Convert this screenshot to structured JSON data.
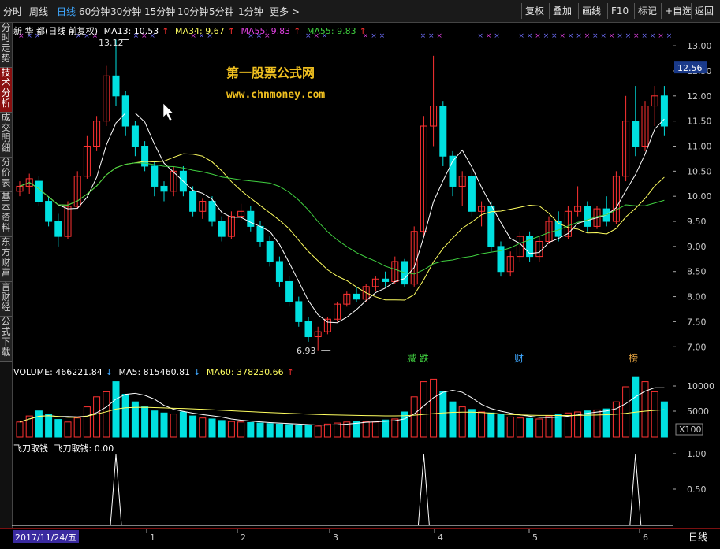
{
  "topbar": {
    "left": [
      "分时",
      "周线",
      "日线",
      "60分钟",
      "30分钟",
      "15分钟",
      "10分钟",
      "5分钟",
      "1分钟",
      "更多 >"
    ],
    "active": "日线",
    "right": [
      "复权",
      "叠加",
      "画线",
      "F10",
      "标记",
      "+自选",
      "返回"
    ]
  },
  "sidebar": [
    "分时走势",
    "技术分析",
    "成交明细",
    "分价表",
    "基本资料",
    "东方财富",
    "言财经",
    "公式下载"
  ],
  "sidebar_active": "技术分析",
  "main_legend": {
    "title": "新 华 都(日线 前复权)",
    "ma13": "MA13: 10.53",
    "ma34": "MA34: 9.67",
    "ma55a": "MA55: 9.83",
    "ma55b": "MA55: 9.83"
  },
  "watermark": {
    "line1": "第一股票公式网",
    "line2": "www.chnmoney.com"
  },
  "annotations": {
    "high": "13.12",
    "low": "6.93",
    "tag1": "减 跌",
    "tag2": "财",
    "tag3": "榜"
  },
  "current_price": "12.56",
  "price_ticks": [
    "13.00",
    "12.50",
    "12.00",
    "11.50",
    "11.00",
    "10.50",
    "10.00",
    "9.50",
    "9.00",
    "8.50",
    "8.00",
    "7.50",
    "7.00"
  ],
  "vol_legend": {
    "vol": "VOLUME: 466221.84",
    "ma5": "MA5: 815460.81",
    "ma60": "MA60: 378230.66"
  },
  "vol_ticks": [
    "10000",
    "5000"
  ],
  "vol_unit": "X100",
  "ind_legend": {
    "name": "飞刀取钱",
    "value": "飞刀取钱: 0.00"
  },
  "ind_ticks": [
    "1.00",
    "0.50"
  ],
  "date_label": "2017/11/24/五",
  "month_ticks": [
    "1",
    "2",
    "3",
    "4",
    "5",
    "6"
  ],
  "period_label": "日线",
  "colors": {
    "up": "#ff3232",
    "down": "#00e0e0",
    "ma13": "#ffffff",
    "ma34": "#ffff60",
    "ma55": "#40d040",
    "accent": "#3fa8ff"
  },
  "chart_data": {
    "type": "candlestick",
    "ylim": [
      6.8,
      13.3
    ],
    "high_marker": 13.12,
    "low_marker": 6.93,
    "candles": [
      [
        10.1,
        10.3,
        10.0,
        10.2
      ],
      [
        10.2,
        10.45,
        10.05,
        10.35
      ],
      [
        10.3,
        10.4,
        9.8,
        9.9
      ],
      [
        9.9,
        10.0,
        9.4,
        9.5
      ],
      [
        9.5,
        9.65,
        9.0,
        9.2
      ],
      [
        9.2,
        9.9,
        9.15,
        9.8
      ],
      [
        9.8,
        10.5,
        9.75,
        10.4
      ],
      [
        10.4,
        11.2,
        10.35,
        11.0
      ],
      [
        11.0,
        11.6,
        10.9,
        11.5
      ],
      [
        11.5,
        12.6,
        11.4,
        12.4
      ],
      [
        12.4,
        13.12,
        11.8,
        12.0
      ],
      [
        12.0,
        12.1,
        11.2,
        11.4
      ],
      [
        11.4,
        11.5,
        10.8,
        11.0
      ],
      [
        11.0,
        11.1,
        10.5,
        10.6
      ],
      [
        10.6,
        10.7,
        10.0,
        10.2
      ],
      [
        10.2,
        10.3,
        9.9,
        10.1
      ],
      [
        10.1,
        10.6,
        10.0,
        10.5
      ],
      [
        10.5,
        10.6,
        10.0,
        10.1
      ],
      [
        10.1,
        10.2,
        9.6,
        9.7
      ],
      [
        9.7,
        9.95,
        9.55,
        9.9
      ],
      [
        9.9,
        10.0,
        9.4,
        9.5
      ],
      [
        9.5,
        9.6,
        9.1,
        9.2
      ],
      [
        9.2,
        9.7,
        9.15,
        9.6
      ],
      [
        9.6,
        9.85,
        9.5,
        9.7
      ],
      [
        9.7,
        9.8,
        9.3,
        9.4
      ],
      [
        9.4,
        9.5,
        9.0,
        9.1
      ],
      [
        9.1,
        9.2,
        8.6,
        8.7
      ],
      [
        8.7,
        8.8,
        8.2,
        8.3
      ],
      [
        8.3,
        8.4,
        7.8,
        7.9
      ],
      [
        7.9,
        8.0,
        7.4,
        7.5
      ],
      [
        7.5,
        7.6,
        7.1,
        7.2
      ],
      [
        7.2,
        7.4,
        6.93,
        7.3
      ],
      [
        7.3,
        7.6,
        7.25,
        7.55
      ],
      [
        7.55,
        7.9,
        7.5,
        7.85
      ],
      [
        7.85,
        8.1,
        7.8,
        8.05
      ],
      [
        8.05,
        8.2,
        7.9,
        7.95
      ],
      [
        7.95,
        8.25,
        7.9,
        8.2
      ],
      [
        8.2,
        8.4,
        8.1,
        8.35
      ],
      [
        8.35,
        8.5,
        8.2,
        8.3
      ],
      [
        8.3,
        8.8,
        8.25,
        8.7
      ],
      [
        8.7,
        8.75,
        8.2,
        8.25
      ],
      [
        8.25,
        9.4,
        8.2,
        9.3
      ],
      [
        9.3,
        11.6,
        9.2,
        11.4
      ],
      [
        11.4,
        12.8,
        11.0,
        11.8
      ],
      [
        11.8,
        11.9,
        10.6,
        10.8
      ],
      [
        10.8,
        10.9,
        10.0,
        10.2
      ],
      [
        10.2,
        10.5,
        9.8,
        10.4
      ],
      [
        10.4,
        10.5,
        9.6,
        9.7
      ],
      [
        9.7,
        9.9,
        9.4,
        9.8
      ],
      [
        9.8,
        9.9,
        8.9,
        9.0
      ],
      [
        9.0,
        9.1,
        8.4,
        8.5
      ],
      [
        8.5,
        8.9,
        8.4,
        8.8
      ],
      [
        8.8,
        9.3,
        8.7,
        9.2
      ],
      [
        9.2,
        9.3,
        8.7,
        8.8
      ],
      [
        8.8,
        9.2,
        8.7,
        9.1
      ],
      [
        9.1,
        9.6,
        9.05,
        9.5
      ],
      [
        9.5,
        9.7,
        9.1,
        9.2
      ],
      [
        9.2,
        9.8,
        9.15,
        9.7
      ],
      [
        9.7,
        10.2,
        9.6,
        9.8
      ],
      [
        9.8,
        9.9,
        9.3,
        9.4
      ],
      [
        9.4,
        9.8,
        9.35,
        9.75
      ],
      [
        9.75,
        10.0,
        9.4,
        9.5
      ],
      [
        9.5,
        10.5,
        9.45,
        10.4
      ],
      [
        10.4,
        12.0,
        10.3,
        11.5
      ],
      [
        11.5,
        12.2,
        10.8,
        11.0
      ],
      [
        11.0,
        11.9,
        10.9,
        11.8
      ],
      [
        11.8,
        12.2,
        11.4,
        12.0
      ],
      [
        12.0,
        12.2,
        11.2,
        11.4
      ]
    ],
    "volume": [
      300,
      420,
      520,
      460,
      350,
      300,
      380,
      600,
      800,
      900,
      1100,
      850,
      700,
      600,
      520,
      480,
      460,
      500,
      420,
      380,
      360,
      330,
      310,
      300,
      290,
      280,
      270,
      260,
      250,
      240,
      230,
      220,
      260,
      280,
      300,
      320,
      310,
      300,
      340,
      360,
      500,
      800,
      1100,
      1150,
      900,
      700,
      600,
      550,
      500,
      480,
      450,
      400,
      380,
      370,
      360,
      420,
      450,
      480,
      500,
      520,
      540,
      560,
      700,
      1000,
      1200,
      1100,
      900,
      700
    ],
    "indicator_spikes": [
      10,
      42,
      64
    ]
  }
}
